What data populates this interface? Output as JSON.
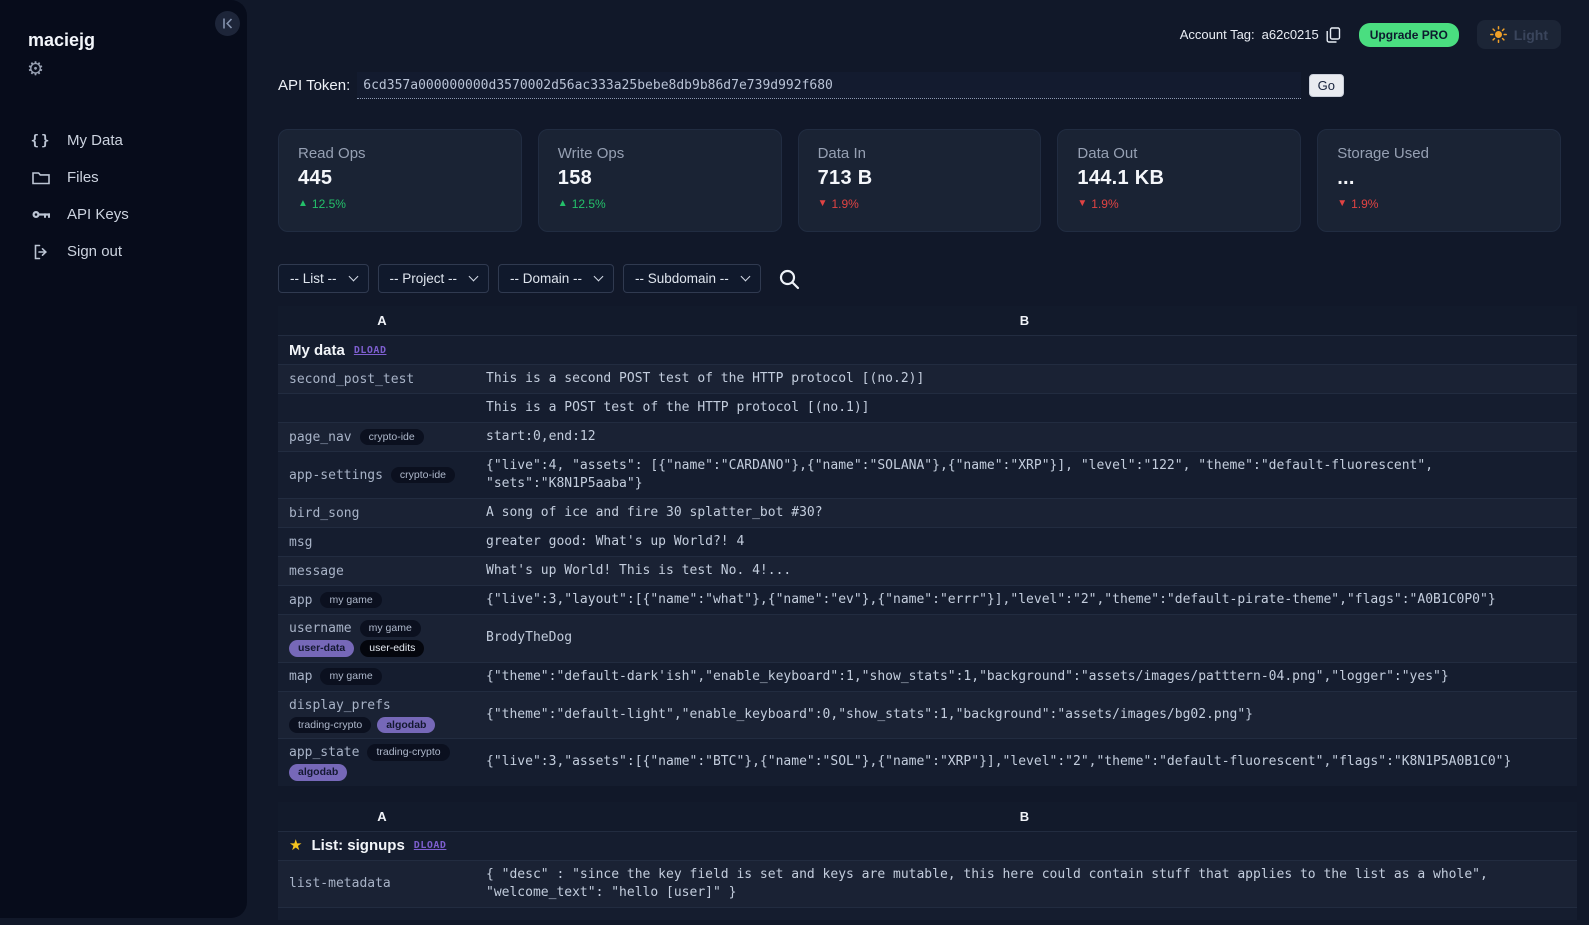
{
  "sidebar": {
    "username": "maciejg",
    "collapse_icon": "collapse-sidebar-icon",
    "settings_icon": "gear-icon",
    "nav": [
      {
        "label": "My Data",
        "icon": "braces-icon"
      },
      {
        "label": "Files",
        "icon": "folder-icon"
      },
      {
        "label": "API Keys",
        "icon": "key-icon"
      },
      {
        "label": "Sign out",
        "icon": "signout-icon"
      }
    ]
  },
  "topbar": {
    "account_tag_label": "Account Tag:",
    "account_tag_value": "a62c0215",
    "copy_icon": "copy-icon",
    "upgrade_label": "Upgrade PRO",
    "theme_toggle_icon": "sun-icon",
    "theme_toggle_label": "Light"
  },
  "api_token": {
    "label": "API Token:",
    "value": "6cd357a000000000d3570002d56ac333a25bebe8db9b86d7e739d992f680",
    "go_label": "Go"
  },
  "stats": [
    {
      "title": "Read Ops",
      "value": "445",
      "delta": "12.5%",
      "direction": "up"
    },
    {
      "title": "Write Ops",
      "value": "158",
      "delta": "12.5%",
      "direction": "up"
    },
    {
      "title": "Data In",
      "value": "713 B",
      "delta": "1.9%",
      "direction": "down"
    },
    {
      "title": "Data Out",
      "value": "144.1 KB",
      "delta": "1.9%",
      "direction": "down"
    },
    {
      "title": "Storage Used",
      "value": "...",
      "delta": "1.9%",
      "direction": "down"
    }
  ],
  "filters": {
    "selects": [
      "-- List --",
      "-- Project --",
      "-- Domain --",
      "-- Subdomain --"
    ],
    "search_icon": "search-icon"
  },
  "tables": [
    {
      "columns": [
        "A",
        "B"
      ],
      "title_row": {
        "title": "My data",
        "link": "DLOAD",
        "starred": false
      },
      "rows": [
        {
          "key": "second_post_test",
          "value": "This is a second POST test of the HTTP protocol [(no.2)]"
        },
        {
          "key": "",
          "value": "This is a POST test of the HTTP protocol [(no.1)]"
        },
        {
          "key": "page_nav",
          "badges": [
            {
              "label": "crypto-ide",
              "style": "dark"
            }
          ],
          "value": "start:0,end:12"
        },
        {
          "key": "app-settings",
          "badges": [
            {
              "label": "crypto-ide",
              "style": "dark"
            }
          ],
          "value": "{\"live\":4, \"assets\": [{\"name\":\"CARDANO\"},{\"name\":\"SOLANA\"},{\"name\":\"XRP\"}], \"level\":\"122\", \"theme\":\"default-fluorescent\", \"sets\":\"K8N1P5aaba\"}"
        },
        {
          "key": "bird_song",
          "value": "A song of ice and fire 30 splatter_bot #30?"
        },
        {
          "key": "msg",
          "value": "greater good: What's up World?! 4"
        },
        {
          "key": "message",
          "value": "What's up World! This is test No. 4!..."
        },
        {
          "key": "app",
          "badges": [
            {
              "label": "my game",
              "style": "dark"
            }
          ],
          "value": "{\"live\":3,\"layout\":[{\"name\":\"what\"},{\"name\":\"ev\"},{\"name\":\"errr\"}],\"level\":\"2\",\"theme\":\"default-pirate-theme\",\"flags\":\"A0B1C0P0\"}"
        },
        {
          "key": "username",
          "badges": [
            {
              "label": "my game",
              "style": "dark"
            }
          ],
          "badges2": [
            {
              "label": "user-data",
              "style": "purple"
            },
            {
              "label": "user-edits",
              "style": "black"
            }
          ],
          "value": "BrodyTheDog"
        },
        {
          "key": "map",
          "badges": [
            {
              "label": "my game",
              "style": "dark"
            }
          ],
          "value": "{\"theme\":\"default-dark'ish\",\"enable_keyboard\":1,\"show_stats\":1,\"background\":\"assets/images/patttern-04.png\",\"logger\":\"yes\"}"
        },
        {
          "key": "display_prefs",
          "badges2": [
            {
              "label": "trading-crypto",
              "style": "dark"
            },
            {
              "label": "algodab",
              "style": "purple"
            }
          ],
          "value": "{\"theme\":\"default-light\",\"enable_keyboard\":0,\"show_stats\":1,\"background\":\"assets/images/bg02.png\"}"
        },
        {
          "key": "app_state",
          "badges": [
            {
              "label": "trading-crypto",
              "style": "dark"
            }
          ],
          "badges2": [
            {
              "label": "algodab",
              "style": "purple"
            }
          ],
          "value": "{\"live\":3,\"assets\":[{\"name\":\"BTC\"},{\"name\":\"SOL\"},{\"name\":\"XRP\"}],\"level\":\"2\",\"theme\":\"default-fluorescent\",\"flags\":\"K8N1P5A0B1C0\"}"
        }
      ],
      "trailing_stub": false
    },
    {
      "columns": [
        "A",
        "B"
      ],
      "title_row": {
        "title": "List: signups",
        "link": "DLOAD",
        "starred": true
      },
      "rows": [
        {
          "key": "list-metadata",
          "value": "{ \"desc\" : \"since the key field is set and keys are mutable, this here could contain stuff that applies to the list as a whole\", \"welcome_text\": \"hello [user]\" }"
        }
      ],
      "trailing_stub": true
    }
  ],
  "colors": {
    "upgrade_green": "#4ade80",
    "delta_up_green": "#24c06a",
    "delta_down_red": "#e04343",
    "dload_link_purple": "#7e5fd0",
    "badge_purple": "#7668b8",
    "star_yellow": "#f5c41f",
    "sun_orange": "#f0a028",
    "sidebar_bg": "#070c1b",
    "page_bg": "#111829",
    "card_bg": "#1a2334"
  }
}
